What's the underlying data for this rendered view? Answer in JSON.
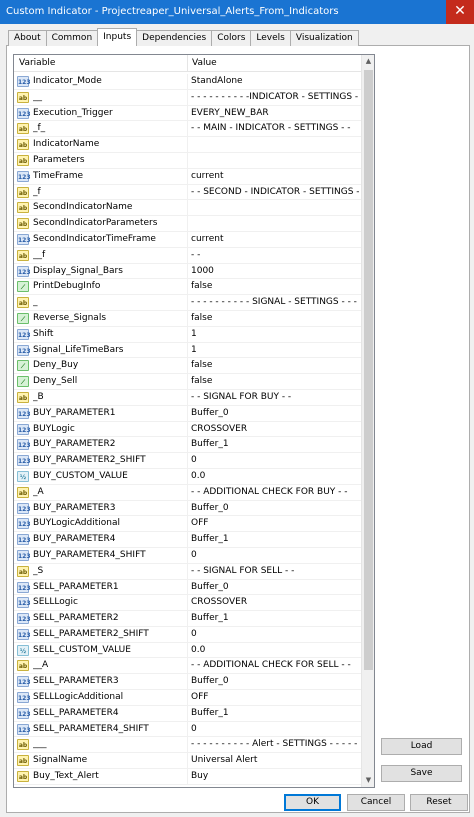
{
  "window": {
    "title": "Custom Indicator - Projectreaper_Universal_Alerts_From_Indicators",
    "close_label": "✕"
  },
  "tabs": [
    "About",
    "Common",
    "Inputs",
    "Dependencies",
    "Colors",
    "Levels",
    "Visualization"
  ],
  "active_tab": "Inputs",
  "grid": {
    "header": {
      "variable": "Variable",
      "value": "Value"
    },
    "rows": [
      {
        "icon": "123",
        "type": "num",
        "var": "Indicator_Mode",
        "val": "StandAlone"
      },
      {
        "icon": "ab",
        "type": "str",
        "var": "__",
        "val": "- - - - - - - - - -INDICATOR - SETTINGS - - - ..."
      },
      {
        "icon": "123",
        "type": "num",
        "var": "Execution_Trigger",
        "val": "EVERY_NEW_BAR"
      },
      {
        "icon": "ab",
        "type": "str",
        "var": "_f_",
        "val": "- -  MAIN - INDICATOR - SETTINGS - -"
      },
      {
        "icon": "ab",
        "type": "str",
        "var": "IndicatorName",
        "val": ""
      },
      {
        "icon": "ab",
        "type": "str",
        "var": "Parameters",
        "val": ""
      },
      {
        "icon": "123",
        "type": "num",
        "var": "TimeFrame",
        "val": "current"
      },
      {
        "icon": "ab",
        "type": "str",
        "var": "_f",
        "val": "- -  SECOND - INDICATOR - SETTINGS - -"
      },
      {
        "icon": "ab",
        "type": "str",
        "var": "SecondIndicatorName",
        "val": ""
      },
      {
        "icon": "ab",
        "type": "str",
        "var": "SecondIndicatorParameters",
        "val": ""
      },
      {
        "icon": "123",
        "type": "num",
        "var": "SecondIndicatorTimeFrame",
        "val": "current"
      },
      {
        "icon": "ab",
        "type": "str",
        "var": "__f",
        "val": "- -"
      },
      {
        "icon": "123",
        "type": "num",
        "var": "Display_Signal_Bars",
        "val": "1000"
      },
      {
        "icon": "bool",
        "type": "bool",
        "var": "PrintDebugInfo",
        "val": "false"
      },
      {
        "icon": "ab",
        "type": "str",
        "var": "_",
        "val": "- - - - - - - - - - SIGNAL - SETTINGS - - - - - - ..."
      },
      {
        "icon": "bool",
        "type": "bool",
        "var": "Reverse_Signals",
        "val": "false"
      },
      {
        "icon": "123",
        "type": "num",
        "var": "Shift",
        "val": "1"
      },
      {
        "icon": "123",
        "type": "num",
        "var": "Signal_LifeTimeBars",
        "val": "1"
      },
      {
        "icon": "bool",
        "type": "bool",
        "var": "Deny_Buy",
        "val": "false"
      },
      {
        "icon": "bool",
        "type": "bool",
        "var": "Deny_Sell",
        "val": "false"
      },
      {
        "icon": "ab",
        "type": "str",
        "var": "_B",
        "val": "- -  SIGNAL FOR BUY - -"
      },
      {
        "icon": "123",
        "type": "num",
        "var": "BUY_PARAMETER1",
        "val": "Buffer_0"
      },
      {
        "icon": "123",
        "type": "num",
        "var": "BUYLogic",
        "val": "CROSSOVER"
      },
      {
        "icon": "123",
        "type": "num",
        "var": "BUY_PARAMETER2",
        "val": "Buffer_1"
      },
      {
        "icon": "123",
        "type": "num",
        "var": "BUY_PARAMETER2_SHIFT",
        "val": "0"
      },
      {
        "icon": "½",
        "type": "dbl",
        "var": "BUY_CUSTOM_VALUE",
        "val": "0.0"
      },
      {
        "icon": "ab",
        "type": "str",
        "var": "_A",
        "val": "- -  ADDITIONAL CHECK FOR BUY - -"
      },
      {
        "icon": "123",
        "type": "num",
        "var": "BUY_PARAMETER3",
        "val": "Buffer_0"
      },
      {
        "icon": "123",
        "type": "num",
        "var": "BUYLogicAdditional",
        "val": "OFF"
      },
      {
        "icon": "123",
        "type": "num",
        "var": "BUY_PARAMETER4",
        "val": "Buffer_1"
      },
      {
        "icon": "123",
        "type": "num",
        "var": "BUY_PARAMETER4_SHIFT",
        "val": "0"
      },
      {
        "icon": "ab",
        "type": "str",
        "var": "_S",
        "val": "- -  SIGNAL FOR SELL - -"
      },
      {
        "icon": "123",
        "type": "num",
        "var": "SELL_PARAMETER1",
        "val": "Buffer_0"
      },
      {
        "icon": "123",
        "type": "num",
        "var": "SELLLogic",
        "val": "CROSSOVER"
      },
      {
        "icon": "123",
        "type": "num",
        "var": "SELL_PARAMETER2",
        "val": "Buffer_1"
      },
      {
        "icon": "123",
        "type": "num",
        "var": "SELL_PARAMETER2_SHIFT",
        "val": "0"
      },
      {
        "icon": "½",
        "type": "dbl",
        "var": "SELL_CUSTOM_VALUE",
        "val": "0.0"
      },
      {
        "icon": "ab",
        "type": "str",
        "var": "__A",
        "val": "- -  ADDITIONAL CHECK FOR SELL - -"
      },
      {
        "icon": "123",
        "type": "num",
        "var": "SELL_PARAMETER3",
        "val": "Buffer_0"
      },
      {
        "icon": "123",
        "type": "num",
        "var": "SELLLogicAdditional",
        "val": "OFF"
      },
      {
        "icon": "123",
        "type": "num",
        "var": "SELL_PARAMETER4",
        "val": "Buffer_1"
      },
      {
        "icon": "123",
        "type": "num",
        "var": "SELL_PARAMETER4_SHIFT",
        "val": "0"
      },
      {
        "icon": "ab",
        "type": "str",
        "var": "___",
        "val": "- - - - - - - - - - Alert - SETTINGS - - - - - - - - - -"
      },
      {
        "icon": "ab",
        "type": "str",
        "var": "SignalName",
        "val": "Universal Alert"
      },
      {
        "icon": "ab",
        "type": "str",
        "var": "Buy_Text_Alert",
        "val": "Buy"
      }
    ]
  },
  "buttons": {
    "load": "Load",
    "save": "Save",
    "ok": "OK",
    "cancel": "Cancel",
    "reset": "Reset"
  }
}
